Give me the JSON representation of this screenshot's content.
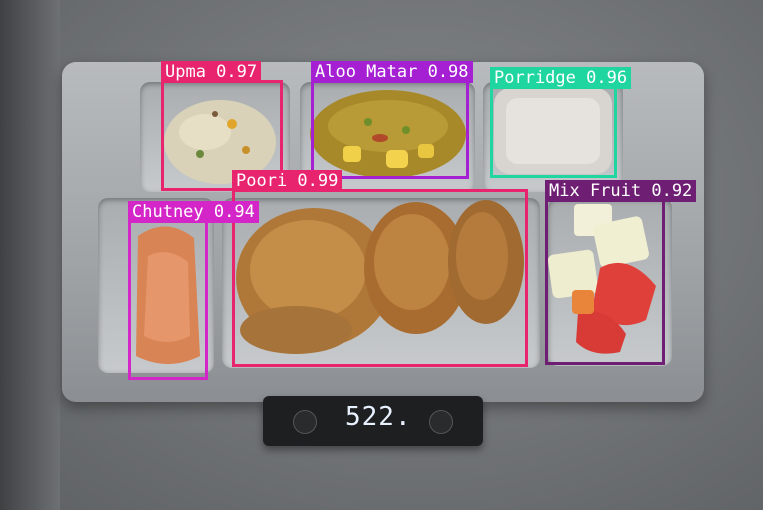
{
  "scale": {
    "readout": "522."
  },
  "detections": [
    {
      "label": "Upma 0.97",
      "color": "#e8246f",
      "icon": "upma-food"
    },
    {
      "label": "Aloo Matar 0.98",
      "color": "#a51fd3",
      "icon": "aloo-matar-food"
    },
    {
      "label": "Porridge 0.96",
      "color": "#1fd6a0",
      "icon": "porridge-food"
    },
    {
      "label": "Poori 0.99",
      "color": "#e8246f",
      "icon": "poori-food"
    },
    {
      "label": "Chutney 0.94",
      "color": "#d426c8",
      "icon": "chutney-food"
    },
    {
      "label": "Mix Fruit 0.92",
      "color": "#6e1f73",
      "icon": "mix-fruit-food"
    }
  ]
}
